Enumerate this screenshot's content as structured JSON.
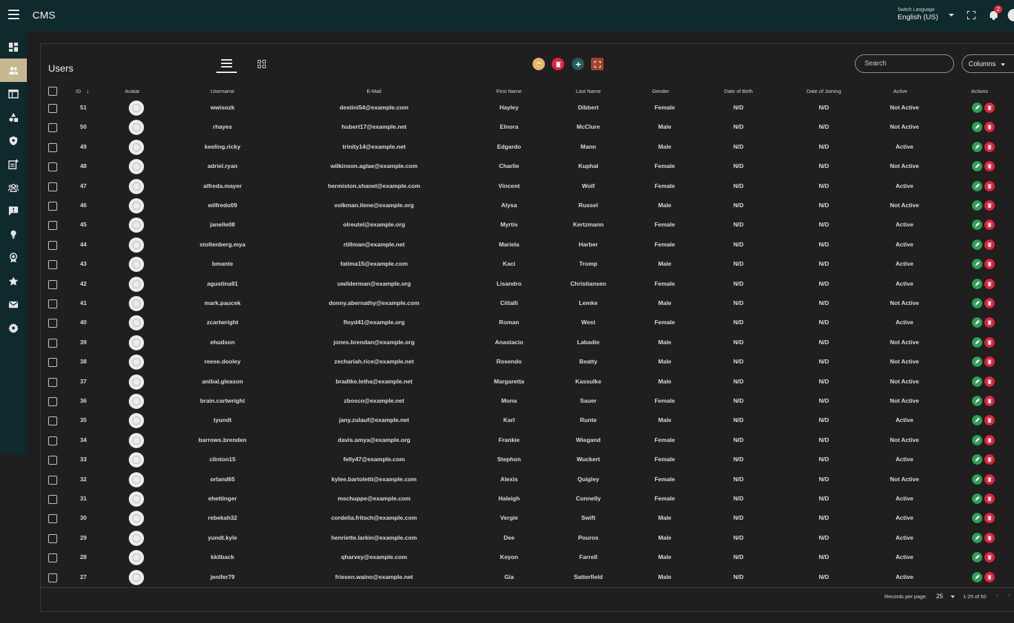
{
  "app": {
    "title": "CMS"
  },
  "topbar": {
    "language_caption": "Switch Language",
    "language_value": "English (US)",
    "notification_count": "2"
  },
  "sidebar": {
    "items": [
      {
        "icon": "dashboard-icon"
      },
      {
        "icon": "users-icon",
        "active": true
      },
      {
        "icon": "table-icon"
      },
      {
        "icon": "shapes-icon"
      },
      {
        "icon": "shield-icon"
      },
      {
        "icon": "post-add-icon"
      },
      {
        "icon": "groups-icon"
      },
      {
        "icon": "chat-icon"
      },
      {
        "icon": "lightbulb-icon"
      },
      {
        "icon": "award-icon"
      },
      {
        "icon": "star-icon"
      },
      {
        "icon": "mail-icon"
      },
      {
        "icon": "settings-icon"
      }
    ]
  },
  "main": {
    "title": "Users",
    "search_placeholder": "Search",
    "columns_label": "Columns"
  },
  "colors": {
    "header_bg": "#0f2a2c",
    "sidebar_active": "#c8b892",
    "edit": "#2f9e58",
    "delete": "#e3233a",
    "add": "#1f5e5a",
    "export": "#a0452c",
    "import": "#e8b36a"
  },
  "table": {
    "headers": [
      "ID",
      "Avatar",
      "Username",
      "E-Mail",
      "First Name",
      "Last Name",
      "Gender",
      "Date of Birth",
      "Date of Joining",
      "Active",
      "Actions"
    ],
    "rows": [
      [
        "51",
        "wwisozk",
        "destini54@example.com",
        "Hayley",
        "Dibbert",
        "Female",
        "N/D",
        "N/D",
        "Not Active"
      ],
      [
        "50",
        "rhayes",
        "hubert17@example.net",
        "Elnora",
        "McClure",
        "Male",
        "N/D",
        "N/D",
        "Not Active"
      ],
      [
        "49",
        "keeling.ricky",
        "trinity14@example.net",
        "Edgardo",
        "Mann",
        "Male",
        "N/D",
        "N/D",
        "Active"
      ],
      [
        "48",
        "adriel.ryan",
        "wilkinson.aglae@example.com",
        "Charlie",
        "Kuphal",
        "Female",
        "N/D",
        "N/D",
        "Not Active"
      ],
      [
        "47",
        "alfreda.mayer",
        "hermiston.shanel@example.com",
        "Vincent",
        "Wolf",
        "Female",
        "N/D",
        "N/D",
        "Active"
      ],
      [
        "46",
        "wilfredo09",
        "volkman.ilene@example.org",
        "Alysa",
        "Russel",
        "Male",
        "N/D",
        "N/D",
        "Not Active"
      ],
      [
        "45",
        "janelle08",
        "olreutel@example.org",
        "Myrtis",
        "Kertzmann",
        "Female",
        "N/D",
        "N/D",
        "Active"
      ],
      [
        "44",
        "stoltenberg.mya",
        "rtillman@example.net",
        "Mariela",
        "Harber",
        "Female",
        "N/D",
        "N/D",
        "Active"
      ],
      [
        "43",
        "bmante",
        "fatima15@example.com",
        "Kaci",
        "Tromp",
        "Male",
        "N/D",
        "N/D",
        "Active"
      ],
      [
        "42",
        "agustina91",
        "uwilderman@example.org",
        "Lisandro",
        "Christiansen",
        "Female",
        "N/D",
        "N/D",
        "Active"
      ],
      [
        "41",
        "mark.paucek",
        "donny.abernathy@example.com",
        "Citlalli",
        "Lemke",
        "Male",
        "N/D",
        "N/D",
        "Not Active"
      ],
      [
        "40",
        "zcartwright",
        "floyd41@example.org",
        "Roman",
        "West",
        "Female",
        "N/D",
        "N/D",
        "Active"
      ],
      [
        "39",
        "ehudson",
        "jones.brendan@example.org",
        "Anastacio",
        "Labadie",
        "Male",
        "N/D",
        "N/D",
        "Not Active"
      ],
      [
        "38",
        "reese.dooley",
        "zechariah.rice@example.net",
        "Rosendo",
        "Beatty",
        "Male",
        "N/D",
        "N/D",
        "Not Active"
      ],
      [
        "37",
        "anibal.gleason",
        "bradtke.letha@example.net",
        "Margaretta",
        "Kassulke",
        "Male",
        "N/D",
        "N/D",
        "Not Active"
      ],
      [
        "36",
        "brain.cartwright",
        "zbosco@example.net",
        "Mona",
        "Sauer",
        "Female",
        "N/D",
        "N/D",
        "Not Active"
      ],
      [
        "35",
        "tyundt",
        "jany.zulauf@example.net",
        "Karl",
        "Runte",
        "Male",
        "N/D",
        "N/D",
        "Active"
      ],
      [
        "34",
        "barrows.brenden",
        "davis.amya@example.org",
        "Frankie",
        "Wiegand",
        "Female",
        "N/D",
        "N/D",
        "Not Active"
      ],
      [
        "33",
        "clinton15",
        "felly47@example.com",
        "Stephon",
        "Wuckert",
        "Female",
        "N/D",
        "N/D",
        "Active"
      ],
      [
        "32",
        "orland65",
        "kylee.bartoletti@example.com",
        "Alexis",
        "Quigley",
        "Female",
        "N/D",
        "N/D",
        "Not Active"
      ],
      [
        "31",
        "ehettinger",
        "mschuppe@example.com",
        "Haleigh",
        "Connelly",
        "Female",
        "N/D",
        "N/D",
        "Active"
      ],
      [
        "30",
        "rebekah32",
        "cordelia.fritsch@example.com",
        "Vergie",
        "Swift",
        "Male",
        "N/D",
        "N/D",
        "Active"
      ],
      [
        "29",
        "yundt.kyle",
        "henriette.larkin@example.com",
        "Dee",
        "Pouros",
        "Male",
        "N/D",
        "N/D",
        "Active"
      ],
      [
        "28",
        "kkilback",
        "qharvey@example.com",
        "Keyon",
        "Farrell",
        "Male",
        "N/D",
        "N/D",
        "Active"
      ],
      [
        "27",
        "jenifer79",
        "friesen.waino@example.net",
        "Gia",
        "Satterfield",
        "Male",
        "N/D",
        "N/D",
        "Active"
      ]
    ]
  },
  "pagination": {
    "records_label": "Records per page:",
    "per_page": "25",
    "range": "1-25 of 50"
  }
}
